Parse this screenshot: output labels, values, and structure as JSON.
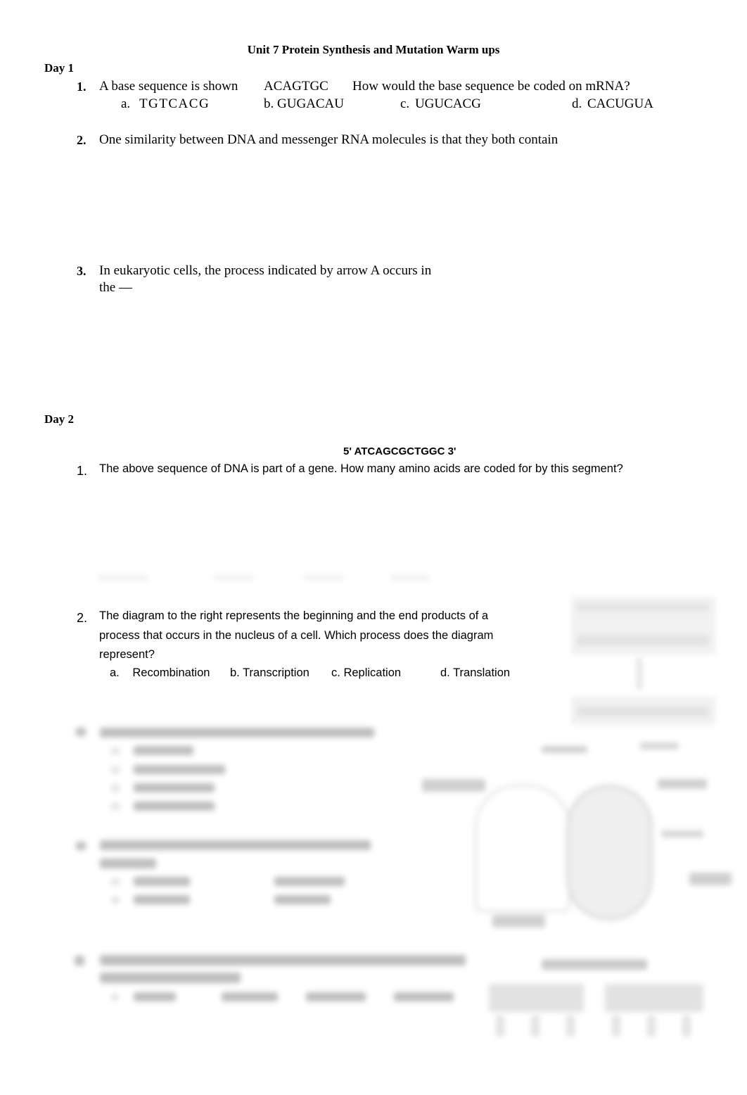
{
  "document": {
    "title": "Unit 7 Protein Synthesis and Mutation Warm ups"
  },
  "day1": {
    "heading": "Day 1",
    "questions": [
      {
        "number": "1.",
        "text": "A base sequence is shown",
        "sequence": "ACAGTGC",
        "prompt": "How would the base sequence be coded on mRNA?",
        "options": [
          {
            "letter": "a.",
            "text": "TGTCACG"
          },
          {
            "letter": "b.",
            "text": "GUGACAU"
          },
          {
            "letter": "c.",
            "text": "UGUCACG"
          },
          {
            "letter": "d.",
            "text": "CACUGUA"
          }
        ]
      },
      {
        "number": "2.",
        "text": "One similarity between DNA and messenger RNA molecules is that they both contain"
      },
      {
        "number": "3.",
        "line1": "In eukaryotic cells, the process indicated by arrow A occurs in",
        "line2": "the —"
      }
    ]
  },
  "day2": {
    "heading": "Day 2",
    "dna_sequence": "5' ATCAGCGCTGGC 3'",
    "questions": [
      {
        "number": "1.",
        "text": "The above sequence of DNA is part of a gene. How many amino acids are coded for by this segment?"
      },
      {
        "number": "2.",
        "line1": "The diagram to the right represents the beginning and the end products of a",
        "line2": "process that occurs in the nucleus of a cell. Which process does the diagram",
        "line3": "represent?",
        "options": [
          {
            "letter": "a.",
            "text": "Recombination"
          },
          {
            "letter": "b.",
            "text": "Transcription"
          },
          {
            "letter": "c.",
            "text": "Replication"
          },
          {
            "letter": "d.",
            "text": "Translation"
          }
        ]
      }
    ]
  },
  "blurred_content": {
    "note": "Remaining questions and diagrams are obscured (blurred preview)"
  }
}
